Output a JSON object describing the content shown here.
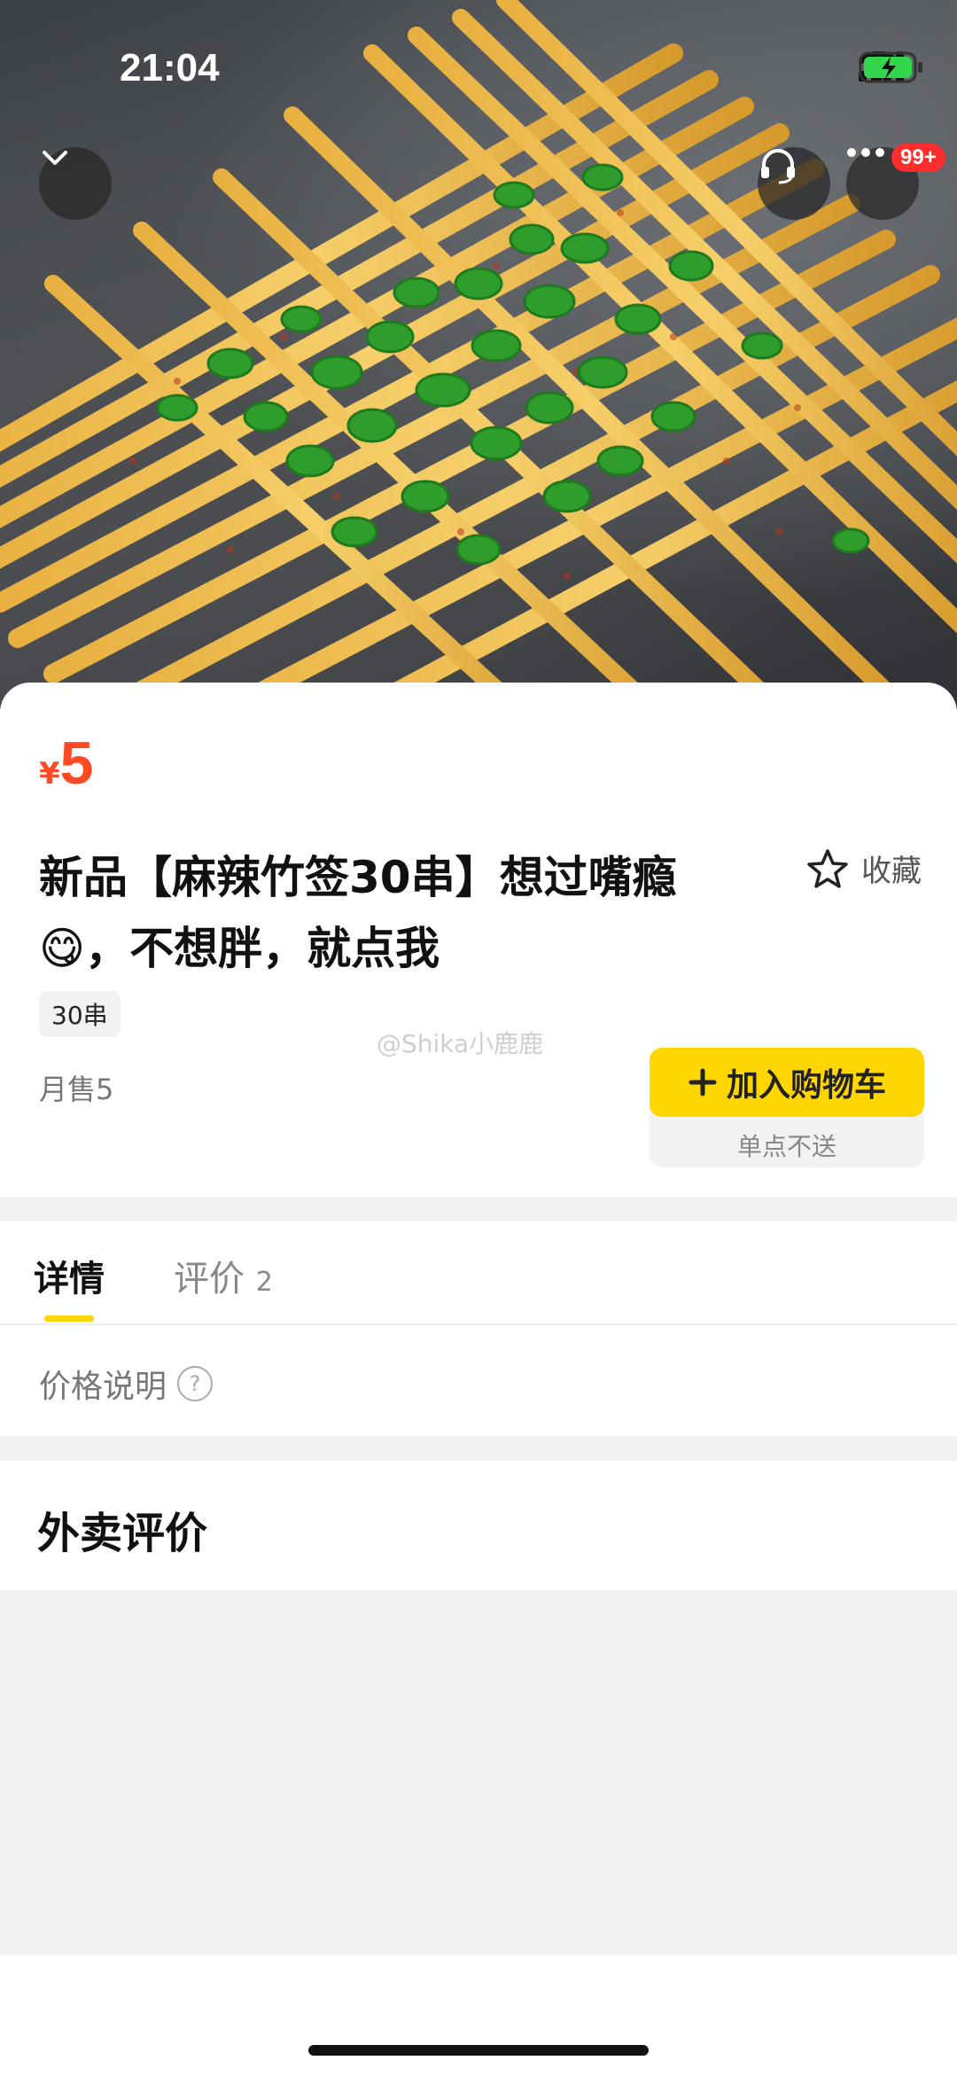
{
  "status_bar": {
    "time": "21:04"
  },
  "product": {
    "currency": "¥",
    "price": "5",
    "title_line1": "新品【麻辣竹签30串】想过嘴瘾",
    "title_line2_emoji": "😋",
    "title_line2": "，不想胖，就点我",
    "favorite_label": "收藏",
    "spec_tag": "30串",
    "monthly_sales": "月售5",
    "add_to_cart": "加入购物车",
    "single_order_note": "单点不送"
  },
  "watermark": "@Shika小鹿鹿",
  "header": {
    "more_badge": "99+"
  },
  "tabs": [
    {
      "label": "详情",
      "count": ""
    },
    {
      "label": "评价",
      "count": "2"
    }
  ],
  "price_explanation": "价格说明",
  "reviews_section_title": "外卖评价",
  "colors": {
    "accent": "#ffd600",
    "price": "#ff4a26",
    "badge": "#ff2d2d"
  }
}
